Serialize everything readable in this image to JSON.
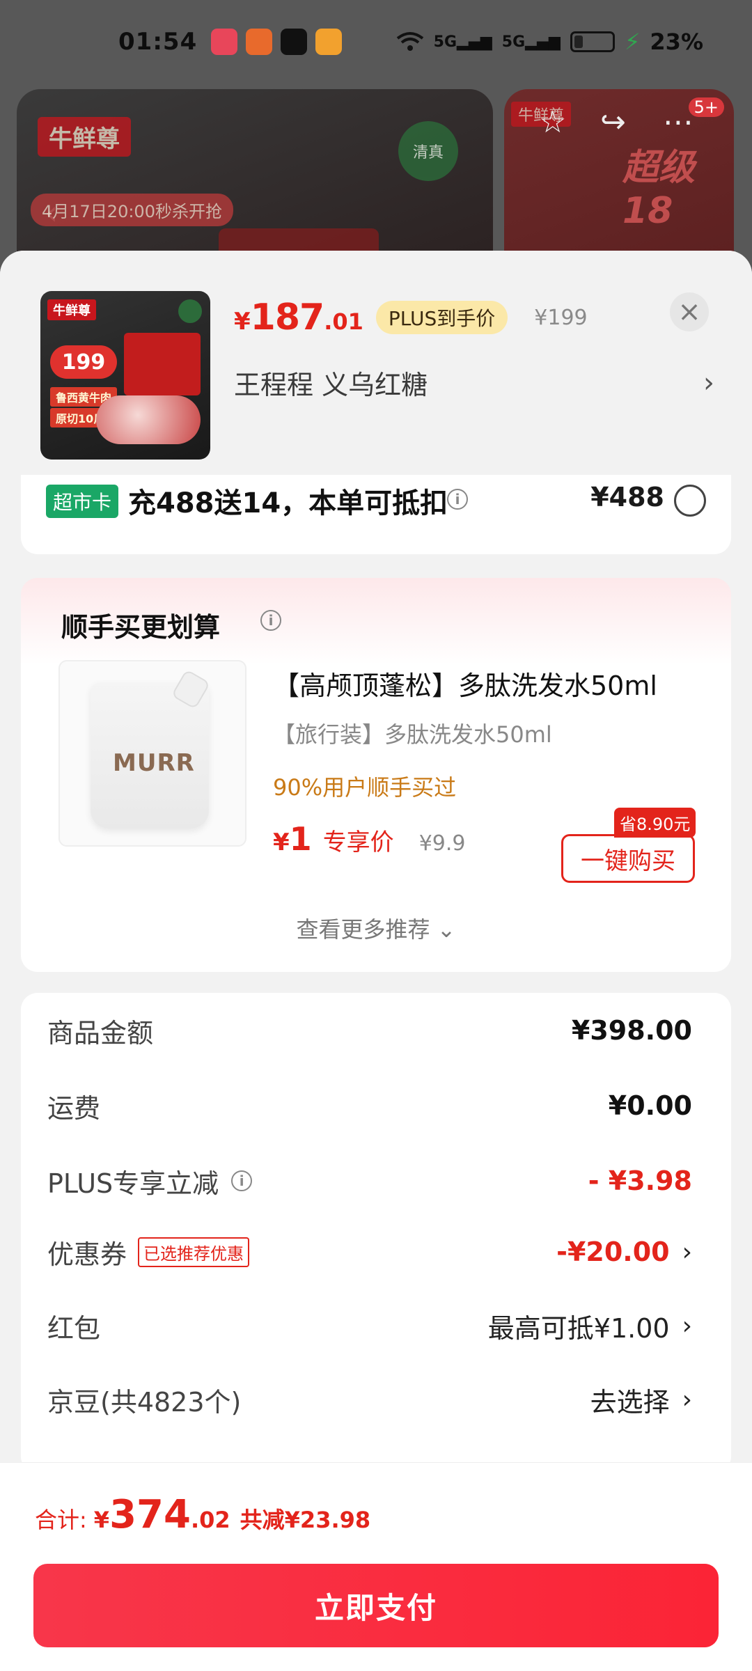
{
  "status_bar": {
    "time": "01:54",
    "signal_1": "5G",
    "signal_2": "5G",
    "battery_percent": "23%",
    "battery_level": 0.23
  },
  "background": {
    "brand_label": "牛鲜尊",
    "halal_label": "清真",
    "seckill_label": "4月17日20:00秒杀开抢",
    "right_brand": "牛鲜尊",
    "right_headline": "超级18",
    "badge_count": "5+"
  },
  "sheet": {
    "price_currency": "¥",
    "price_int": "187",
    "price_dec": ".01",
    "plus_tag": "PLUS到手价",
    "original_price": "¥199",
    "spec": "王程程  义乌红糖",
    "thumb": {
      "brand": "牛鲜尊",
      "price": "199",
      "line1": "鲁西黄牛肉",
      "line2": "原切10斤"
    }
  },
  "supermarket_card": {
    "tag": "超市卡",
    "text": "充488送14，本单可抵扣",
    "amount": "¥488"
  },
  "recommend": {
    "title": "顺手买更划算",
    "product_name": "【高颅顶蓬松】多肽洗发水50ml",
    "product_sub": "【旅行装】多肽洗发水50ml",
    "social_proof": "90%用户顺手买过",
    "currency": "¥",
    "price": "1",
    "price_label": "专享价",
    "original_price": "¥9.9",
    "save_badge": "省8.90元",
    "buy_button": "一键购买",
    "product_brand": "MURR",
    "more": "查看更多推荐 ⌄"
  },
  "summary": {
    "rows": [
      {
        "label": "商品金额",
        "value": "¥398.00"
      },
      {
        "label": "运费",
        "value": "¥0.00"
      },
      {
        "label": "PLUS专享立减",
        "value": "- ¥3.98"
      },
      {
        "label": "优惠券",
        "tag": "已选推荐优惠",
        "value": "-¥20.00"
      },
      {
        "label": "红包",
        "value": "最高可抵¥1.00"
      },
      {
        "label": "京豆(共4823个)",
        "value": "去选择"
      }
    ]
  },
  "bottom": {
    "total_label": "合计:",
    "currency": "¥",
    "total_int": "374",
    "total_dec": ".02",
    "total_save": "共减¥23.98",
    "pay_button": "立即支付"
  },
  "colors": {
    "accent_red": "#e3241b",
    "pay_red": "#fb2436",
    "plus_gold": "#fbe8a8",
    "super_green": "#1aa766",
    "social_orange": "#c97a17"
  },
  "icons": [
    "wifi-icon",
    "signal-icon",
    "battery-icon",
    "charging-icon",
    "back-icon",
    "star-icon",
    "share-icon",
    "more-icon",
    "close-icon",
    "chevron-right-icon",
    "info-icon",
    "radio-icon"
  ]
}
